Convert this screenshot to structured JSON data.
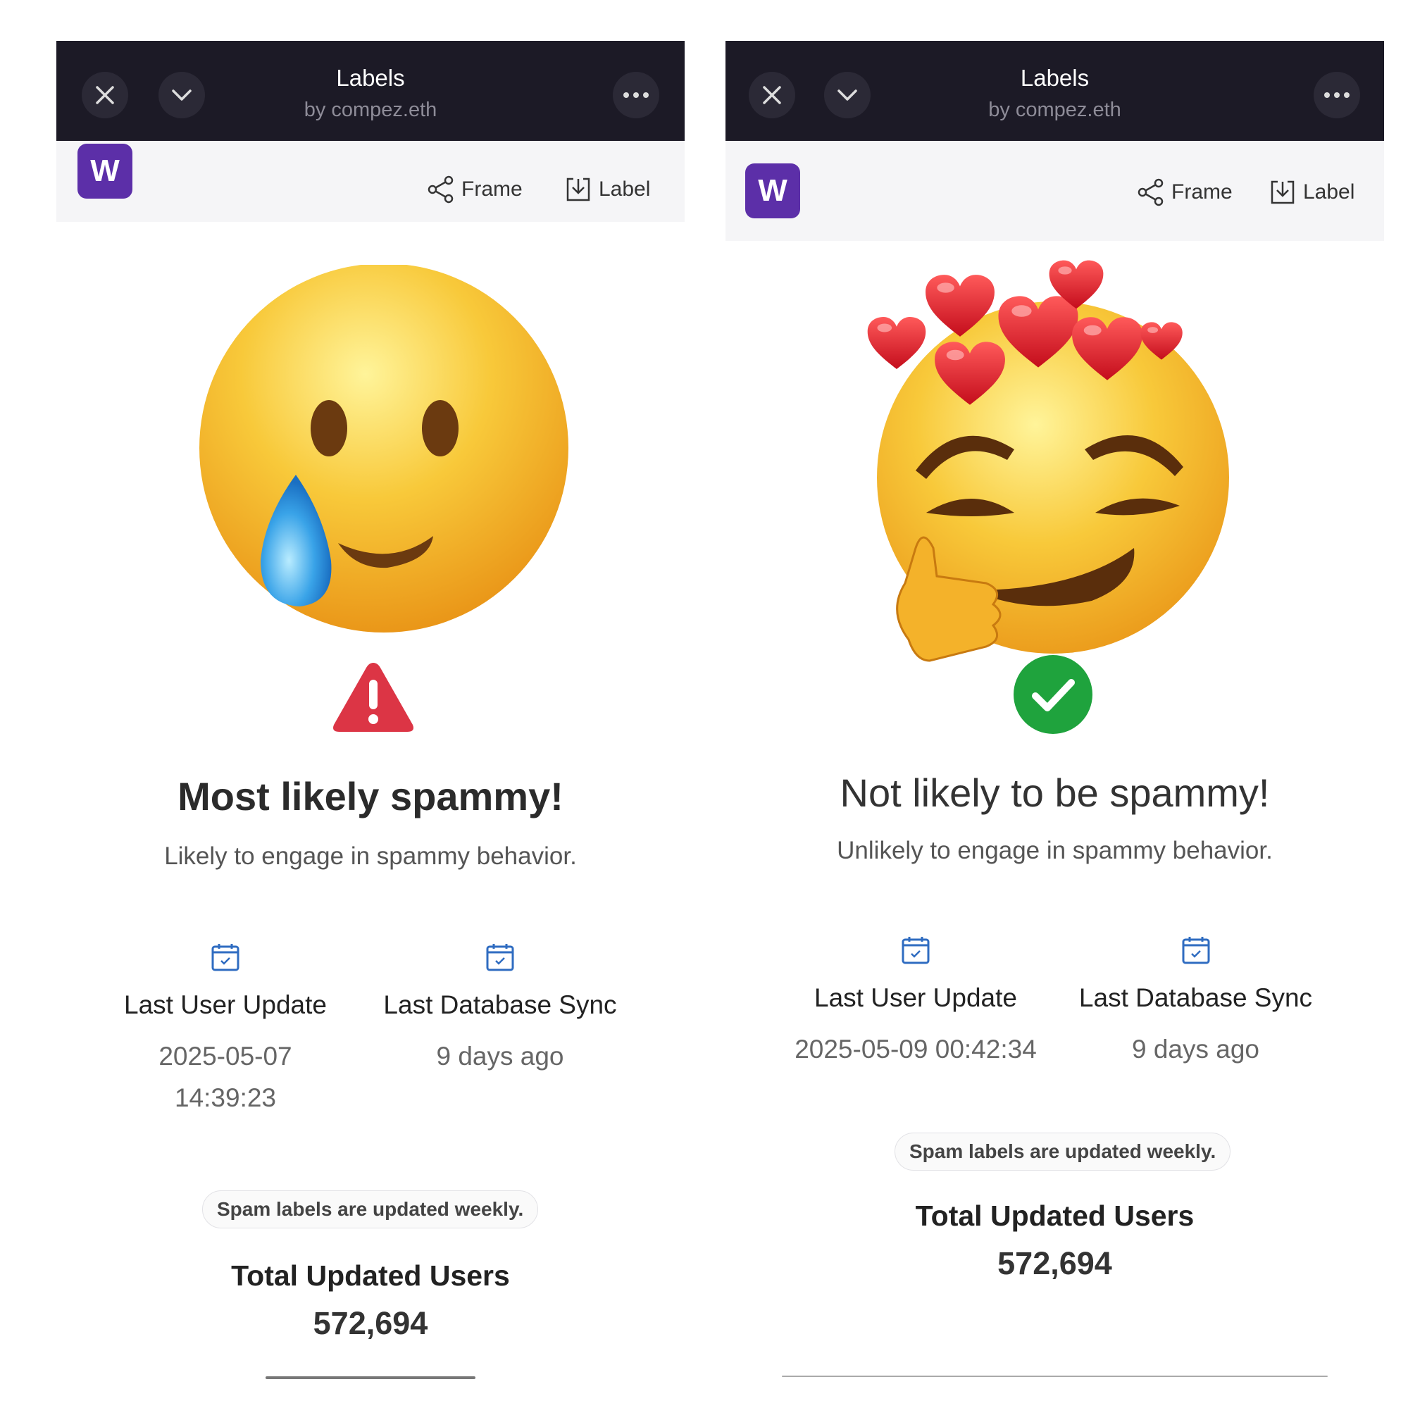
{
  "left": {
    "header": {
      "title": "Labels",
      "subtitle": "by compez.eth"
    },
    "logo_letter": "W",
    "actions": {
      "frame": "Frame",
      "label": "Label"
    },
    "headline": "Most likely spammy!",
    "description": "Likely to engage in spammy behavior.",
    "stats": [
      {
        "label": "Last User Update",
        "value": "2025-05-07 14:39:23"
      },
      {
        "label": "Last Database Sync",
        "value": "9 days ago"
      }
    ],
    "note": "Spam labels are updated weekly.",
    "total": {
      "label": "Total Updated Users",
      "value": "572,694"
    },
    "status": "warning",
    "emoji": "crying-smile"
  },
  "right": {
    "header": {
      "title": "Labels",
      "subtitle": "by compez.eth"
    },
    "logo_letter": "W",
    "actions": {
      "frame": "Frame",
      "label": "Label"
    },
    "headline": "Not likely to be spammy!",
    "description": "Unlikely to engage in spammy behavior.",
    "stats": [
      {
        "label": "Last User Update",
        "value": "2025-05-09 00:42:34"
      },
      {
        "label": "Last Database Sync",
        "value": "9 days ago"
      }
    ],
    "note": "Spam labels are updated weekly.",
    "total": {
      "label": "Total Updated Users",
      "value": "572,694"
    },
    "status": "success",
    "emoji": "smirk-with-hearts"
  },
  "colors": {
    "topbar": "#1c1a26",
    "logo": "#5c2fa8",
    "warning": "#dc3545",
    "success": "#1fa33d",
    "calendar": "#2f6cc1"
  }
}
